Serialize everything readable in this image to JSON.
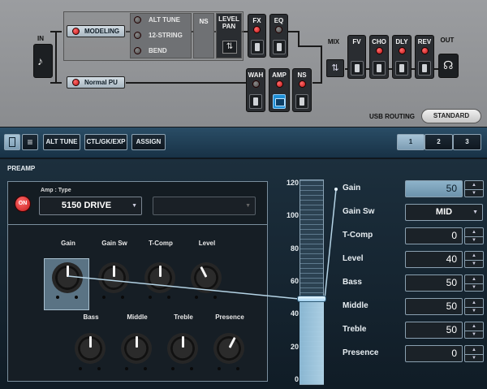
{
  "routing": {
    "input_label": "IN",
    "mix_label": "MIX",
    "output_label": "OUT",
    "modeling_label": "MODELING",
    "normal_pu_label": "Normal PU",
    "selector_items": [
      {
        "label": "ALT TUNE"
      },
      {
        "label": "12-STRING"
      },
      {
        "label": "BEND"
      }
    ],
    "ns_label": "NS",
    "level_pan_label": "LEVEL\nPAN",
    "upper_blocks": [
      {
        "label": "FX"
      },
      {
        "label": "EQ"
      }
    ],
    "lower_blocks": [
      {
        "label": "WAH"
      },
      {
        "label": "AMP"
      },
      {
        "label": "NS"
      }
    ],
    "post_blocks": [
      {
        "label": "FV"
      },
      {
        "label": "CHO"
      },
      {
        "label": "DLY"
      },
      {
        "label": "REV"
      }
    ],
    "usb_routing_label": "USB ROUTING",
    "usb_routing_value": "STANDARD"
  },
  "toolbar": {
    "tabs": [
      {
        "label": "ALT TUNE"
      },
      {
        "label": "CTL/GK/EXP"
      },
      {
        "label": "ASSIGN"
      }
    ],
    "pages": [
      {
        "label": "1"
      },
      {
        "label": "2"
      },
      {
        "label": "3"
      }
    ],
    "active_page": "1"
  },
  "preamp": {
    "section_title": "PREAMP",
    "on_label": "ON",
    "amp_type_label": "Amp : Type",
    "amp_type_value": "5150 DRIVE",
    "second_select_value": "",
    "knobs_row1": [
      {
        "label": "Gain",
        "value": 50
      },
      {
        "label": "Gain Sw",
        "value": 50
      },
      {
        "label": "T-Comp",
        "value": 50
      },
      {
        "label": "Level",
        "value": 40
      }
    ],
    "knobs_row2": [
      {
        "label": "Bass",
        "value": 50
      },
      {
        "label": "Middle",
        "value": 50
      },
      {
        "label": "Treble",
        "value": 50
      },
      {
        "label": "Presence",
        "value": 60
      }
    ],
    "scale_ticks": [
      "120",
      "100",
      "80",
      "60",
      "40",
      "20",
      "0"
    ],
    "slider_value": 50,
    "slider_max": 120,
    "params": [
      {
        "label": "Gain",
        "value": "50",
        "type": "number",
        "active": true
      },
      {
        "label": "Gain Sw",
        "value": "MID",
        "type": "select"
      },
      {
        "label": "T-Comp",
        "value": "0",
        "type": "number"
      },
      {
        "label": "Level",
        "value": "40",
        "type": "number"
      },
      {
        "label": "Bass",
        "value": "50",
        "type": "number"
      },
      {
        "label": "Middle",
        "value": "50",
        "type": "number"
      },
      {
        "label": "Treble",
        "value": "50",
        "type": "number"
      },
      {
        "label": "Presence",
        "value": "0",
        "type": "number"
      }
    ]
  }
}
